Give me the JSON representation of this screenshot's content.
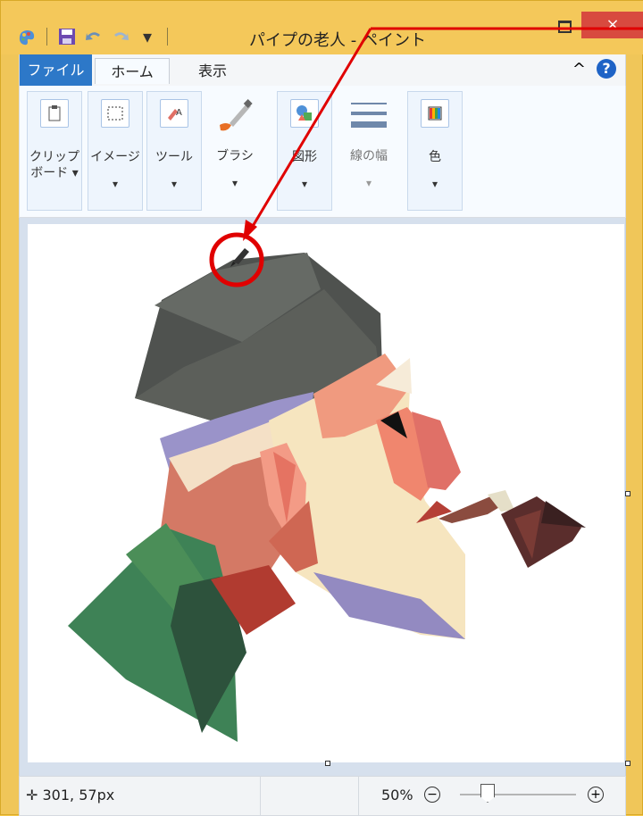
{
  "window": {
    "title": "パイプの老人 - ペイント",
    "close_label": "×"
  },
  "quick_access": {
    "paint_icon": "paint-icon",
    "save_icon": "save-icon",
    "undo_icon": "undo-icon",
    "redo_icon": "redo-icon",
    "dropdown": "▾"
  },
  "tabs": {
    "file": "ファイル",
    "home": "ホーム",
    "view": "表示"
  },
  "ribbon": {
    "clipboard_line1": "クリップ",
    "clipboard_line2": "ボード ▾",
    "image": "イメージ",
    "tools": "ツール",
    "brush": "ブラシ",
    "shapes": "図形",
    "linewidth": "線の幅",
    "color": "色",
    "caret": "▾"
  },
  "status": {
    "coords": "301, 57px",
    "zoom": "50%",
    "zoom_minus": "⊖",
    "zoom_plus": "⊕",
    "zoom_fraction": 0.5
  },
  "colors": {
    "title_bar": "#f4c85a",
    "file_tab": "#2d78c8",
    "close_button": "#d84a3f",
    "annotation": "#e00000"
  }
}
